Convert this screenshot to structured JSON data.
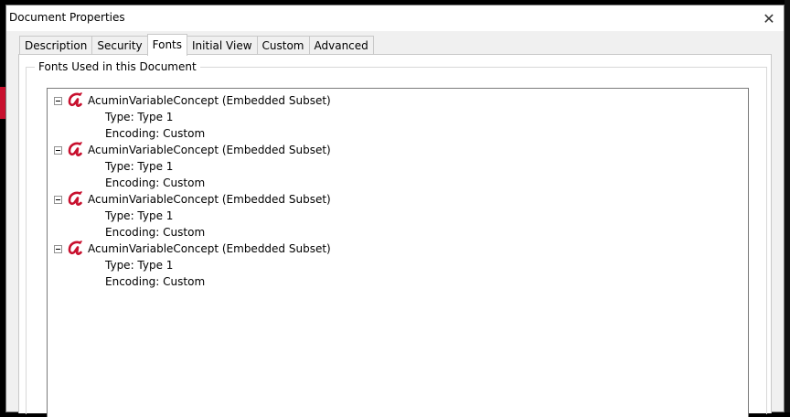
{
  "window": {
    "title": "Document Properties"
  },
  "tabs": [
    {
      "label": "Description"
    },
    {
      "label": "Security"
    },
    {
      "label": "Fonts",
      "active": true
    },
    {
      "label": "Initial View"
    },
    {
      "label": "Custom"
    },
    {
      "label": "Advanced"
    }
  ],
  "group": {
    "legend": "Fonts Used in this Document"
  },
  "fonts": [
    {
      "name": "AcuminVariableConcept (Embedded Subset)",
      "type": "Type: Type 1",
      "encoding": "Encoding: Custom"
    },
    {
      "name": "AcuminVariableConcept (Embedded Subset)",
      "type": "Type: Type 1",
      "encoding": "Encoding: Custom"
    },
    {
      "name": "AcuminVariableConcept (Embedded Subset)",
      "type": "Type: Type 1",
      "encoding": "Encoding: Custom"
    },
    {
      "name": "AcuminVariableConcept (Embedded Subset)",
      "type": "Type: Type 1",
      "encoding": "Encoding: Custom"
    }
  ],
  "icons": {
    "close": "close-icon",
    "font": "type1-font-icon",
    "collapse": "collapse-icon"
  },
  "colors": {
    "font_icon": "#c8102e",
    "dialog_bg": "#f0f0f0",
    "panel_bg": "#ffffff"
  }
}
